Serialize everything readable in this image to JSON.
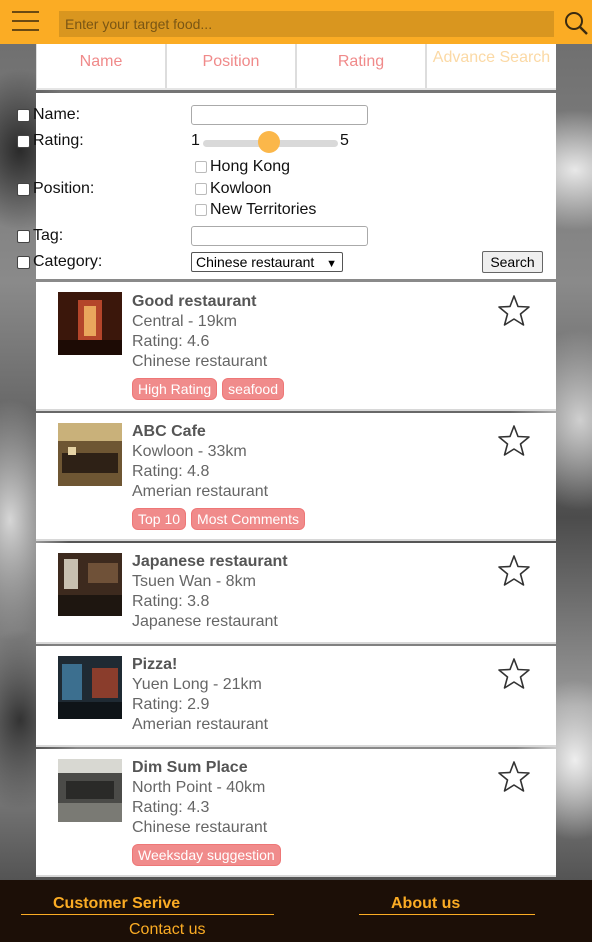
{
  "header": {
    "search_placeholder": "Enter your target food..."
  },
  "sort_tabs": [
    "Name",
    "Position",
    "Rating",
    "Advance Search"
  ],
  "advanced": {
    "name_label": "Name:",
    "rating_label": "Rating:",
    "rating_min": "1",
    "rating_max": "5",
    "position_label": "Position:",
    "positions": [
      "Hong Kong",
      "Kowloon",
      "New Territories"
    ],
    "tag_label": "Tag:",
    "category_label": "Category:",
    "category_selected": "Chinese restaurant",
    "search_button": "Search"
  },
  "restaurants": [
    {
      "name": "Good restaurant",
      "location": "Central - 19km",
      "rating": "Rating: 4.6",
      "category": "Chinese restaurant",
      "tags": [
        "High Rating",
        "seafood"
      ]
    },
    {
      "name": "ABC Cafe",
      "location": "Kowloon - 33km",
      "rating": "Rating: 4.8",
      "category": "Amerian restaurant",
      "tags": [
        "Top 10",
        "Most Comments"
      ]
    },
    {
      "name": "Japanese restaurant",
      "location": "Tsuen Wan - 8km",
      "rating": "Rating: 3.8",
      "category": "Japanese restaurant",
      "tags": []
    },
    {
      "name": "Pizza!",
      "location": "Yuen Long - 21km",
      "rating": "Rating: 2.9",
      "category": "Amerian restaurant",
      "tags": []
    },
    {
      "name": "Dim Sum Place",
      "location": "North Point - 40km",
      "rating": "Rating: 4.3",
      "category": "Chinese restaurant",
      "tags": [
        "Weeksday suggestion"
      ]
    }
  ],
  "footer": {
    "customer_service": "Customer Serive",
    "about_us": "About us",
    "contact_us": "Contact us"
  },
  "colors": {
    "brand": "#fbac24",
    "tag": "#f08b8b",
    "footer_bg": "#1c0f07"
  }
}
